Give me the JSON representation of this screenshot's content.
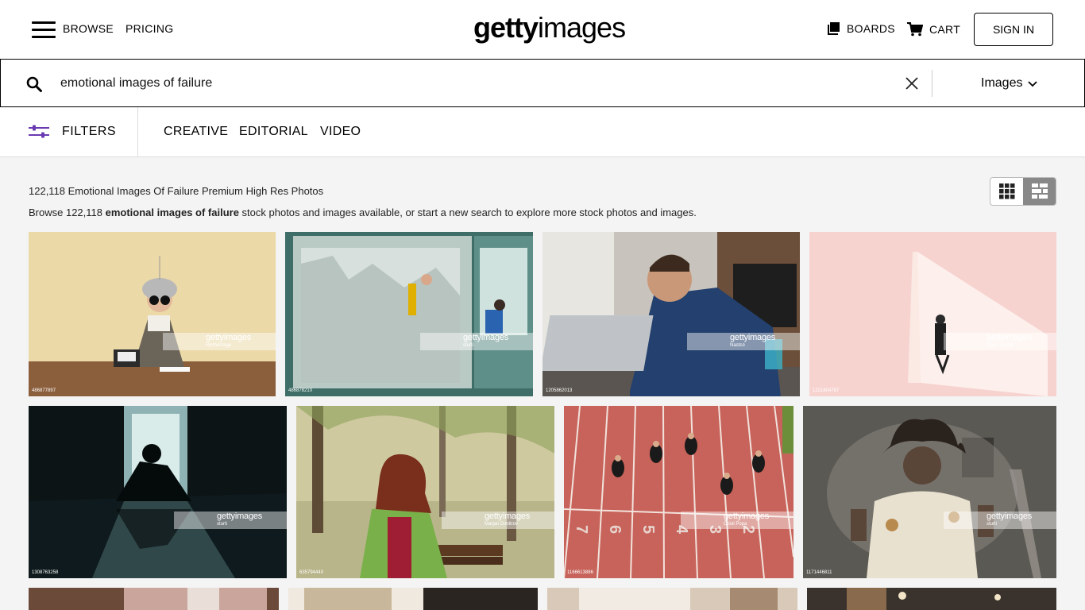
{
  "nav": {
    "browse": "BROWSE",
    "pricing": "PRICING",
    "logo_bold": "getty",
    "logo_light": "images",
    "boards": "BOARDS",
    "cart": "CART",
    "sign_in": "SIGN IN"
  },
  "search": {
    "value": "emotional images of failure",
    "media_type": "Images"
  },
  "filterbar": {
    "filters": "FILTERS",
    "tabs": [
      "CREATIVE",
      "EDITORIAL",
      "VIDEO"
    ]
  },
  "results": {
    "title": "122,118 Emotional Images Of Failure Premium High Res Photos",
    "desc_prefix": "Browse 122,118 ",
    "desc_bold": "emotional images of failure",
    "desc_suffix": " stock photos and images available, or start a new search to explore more stock photos and images."
  },
  "watermark": "gettyimages",
  "tiles": [
    {
      "credit": "RichVintage",
      "id": "486877897"
    },
    {
      "credit": "sturti",
      "id": "486878210"
    },
    {
      "credit": "Nastco",
      "id": "1205862013"
    },
    {
      "credit": "Klaus Vedfelt",
      "id": "1221804787"
    },
    {
      "credit": "sturti",
      "id": "1308763258"
    },
    {
      "credit": "Marjan Dimitrov",
      "id": "635794440"
    },
    {
      "credit": "Cristi Popa",
      "id": "1166613886"
    },
    {
      "credit": "sturti",
      "id": "1171446811"
    }
  ],
  "colors": {
    "accent_purple": "#6a3ab2",
    "text": "#000000",
    "page_bg": "#f4f4f4"
  }
}
